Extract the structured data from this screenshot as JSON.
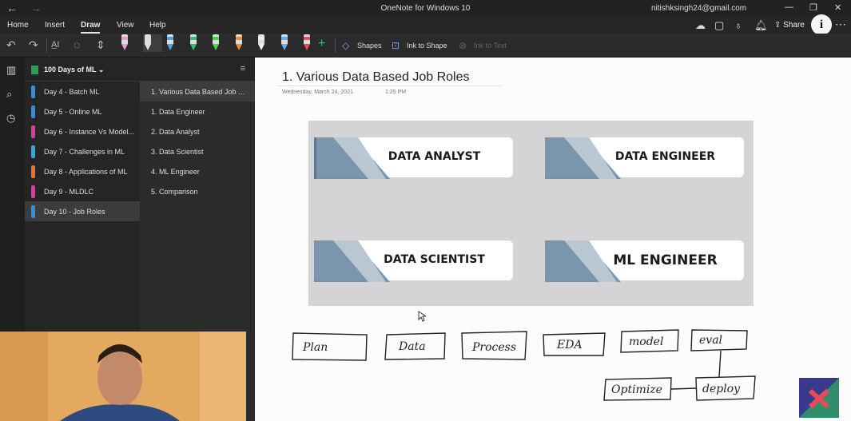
{
  "window": {
    "title": "OneNote for Windows 10",
    "user_email": "nitishksingh24@gmail.com"
  },
  "menu": {
    "items": [
      "Home",
      "Insert",
      "Draw",
      "View",
      "Help"
    ],
    "active": "Draw",
    "share_label": "Share"
  },
  "toolbar": {
    "shapes_label": "Shapes",
    "ink_to_shape_label": "Ink to Shape",
    "ink_to_text_label": "Ink to Text",
    "pen_colors": [
      "#e9a0c8",
      "#dddddd",
      "#4aa3e8",
      "#2fc46a",
      "#3cdc3c",
      "#e8903a",
      "#eeeeee",
      "#6ab0f0",
      "#e84a5a"
    ]
  },
  "notebook": {
    "name": "100 Days of ML",
    "sections": [
      {
        "label": "Day 4 - Batch ML",
        "color": "#2f8fe0"
      },
      {
        "label": "Day 5 - Online ML",
        "color": "#2f8fe0"
      },
      {
        "label": "Day 6 - Instance Vs Model...",
        "color": "#e03a9c"
      },
      {
        "label": "Day 7 - Challenges in ML",
        "color": "#2fa9e0"
      },
      {
        "label": "Day 8 - Applications of ML",
        "color": "#e8722a"
      },
      {
        "label": "Day 9 - MLDLC",
        "color": "#e03a9c"
      },
      {
        "label": "Day 10 - Job Roles",
        "color": "#2f8fe0"
      }
    ],
    "active_section": 6
  },
  "pages": {
    "items": [
      "1. Various Data Based Job Ro...",
      "1. Data Engineer",
      "2. Data Analyst",
      "3. Data Scientist",
      "4. ML Engineer",
      "5. Comparison"
    ],
    "active": 0
  },
  "page": {
    "title": "1. Various Data Based Job Roles",
    "date": "Wednesday, March 24, 2021",
    "time": "1:25 PM"
  },
  "slide": {
    "cards": [
      "DATA ANALYST",
      "DATA ENGINEER",
      "DATA SCIENTIST",
      "ML ENGINEER"
    ]
  },
  "sketch": {
    "boxes": [
      "Plan",
      "Data",
      "Process",
      "EDA",
      "model",
      "eval",
      "Optimize",
      "deploy"
    ]
  }
}
